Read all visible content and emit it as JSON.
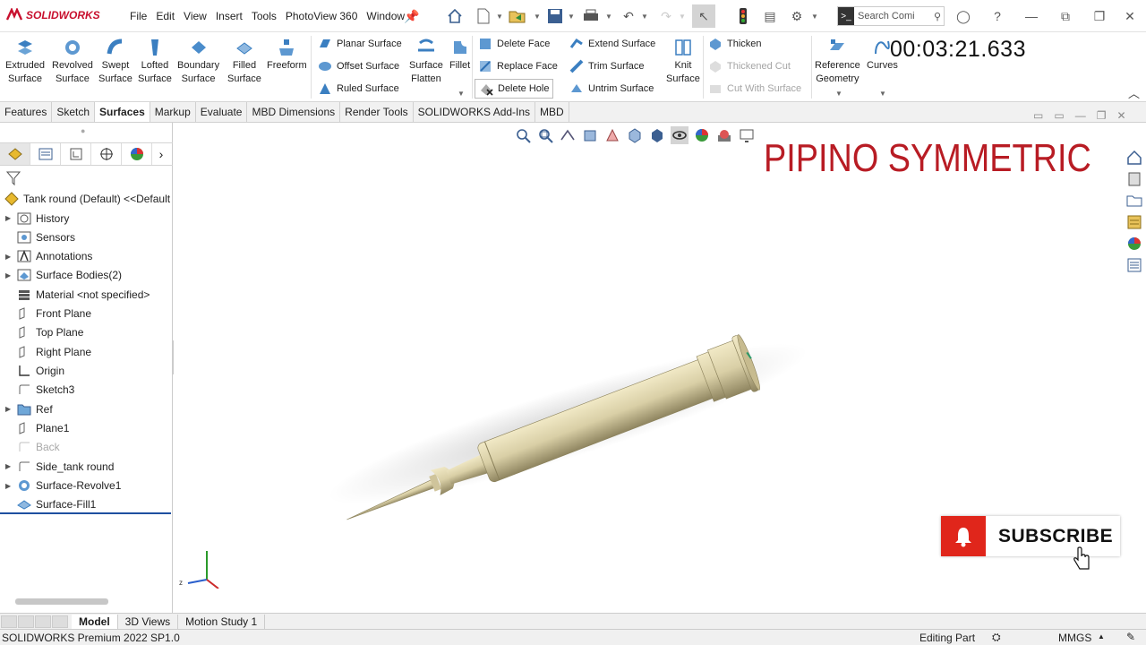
{
  "app": {
    "brand": "SOLIDWORKS"
  },
  "menu": [
    "File",
    "Edit",
    "View",
    "Insert",
    "Tools",
    "PhotoView 360",
    "Window"
  ],
  "search": {
    "placeholder": "Search Comi"
  },
  "ribbon": {
    "extruded_surface": "Extruded\nSurface",
    "revolved_surface": "Revolved\nSurface",
    "swept_surface": "Swept\nSurface",
    "lofted_surface": "Lofted\nSurface",
    "boundary_surface": "Boundary\nSurface",
    "filled_surface": "Filled\nSurface",
    "freeform": "Freeform",
    "planar_surface": "Planar Surface",
    "offset_surface": "Offset Surface",
    "ruled_surface": "Ruled Surface",
    "surface_flatten": "Surface\nFlatten",
    "fillet": "Fillet",
    "delete_face": "Delete Face",
    "replace_face": "Replace Face",
    "delete_hole": "Delete Hole",
    "extend_surface": "Extend Surface",
    "trim_surface": "Trim Surface",
    "untrim_surface": "Untrim Surface",
    "knit_surface": "Knit\nSurface",
    "thicken": "Thicken",
    "thickened_cut": "Thickened Cut",
    "cut_with_surface": "Cut With Surface",
    "reference_geometry": "Reference\nGeometry",
    "curves": "Curves"
  },
  "timer": "00:03:21.633",
  "tabs": [
    "Features",
    "Sketch",
    "Surfaces",
    "Markup",
    "Evaluate",
    "MBD Dimensions",
    "Render Tools",
    "SOLIDWORKS Add-Ins",
    "MBD"
  ],
  "active_tab": "Surfaces",
  "tree": {
    "root": "Tank round (Default) <<Default",
    "items": [
      {
        "label": "History",
        "icon": "history-icon",
        "expand": true,
        "disabled": false
      },
      {
        "label": "Sensors",
        "icon": "sensor-icon",
        "expand": false,
        "disabled": false
      },
      {
        "label": "Annotations",
        "icon": "annotation-icon",
        "expand": true,
        "disabled": false
      },
      {
        "label": "Surface Bodies(2)",
        "icon": "surface-bodies-icon",
        "expand": true,
        "disabled": false
      },
      {
        "label": "Material <not specified>",
        "icon": "material-icon",
        "expand": false,
        "disabled": false
      },
      {
        "label": "Front Plane",
        "icon": "plane-icon",
        "expand": false,
        "disabled": false
      },
      {
        "label": "Top Plane",
        "icon": "plane-icon",
        "expand": false,
        "disabled": false
      },
      {
        "label": "Right Plane",
        "icon": "plane-icon",
        "expand": false,
        "disabled": false
      },
      {
        "label": "Origin",
        "icon": "origin-icon",
        "expand": false,
        "disabled": false
      },
      {
        "label": "Sketch3",
        "icon": "sketch-icon",
        "expand": false,
        "disabled": false
      },
      {
        "label": "Ref",
        "icon": "folder-icon",
        "expand": true,
        "disabled": false
      },
      {
        "label": "Plane1",
        "icon": "plane-icon",
        "expand": false,
        "disabled": false
      },
      {
        "label": "Back",
        "icon": "sketch-icon",
        "expand": false,
        "disabled": true
      },
      {
        "label": "Side_tank round",
        "icon": "sketch-icon",
        "expand": true,
        "disabled": false
      },
      {
        "label": "Surface-Revolve1",
        "icon": "revolve-icon",
        "expand": true,
        "disabled": false
      },
      {
        "label": "Surface-Fill1",
        "icon": "fill-surface-icon",
        "expand": false,
        "disabled": false
      }
    ]
  },
  "overlay": {
    "title": "PIPINO SYMMETRIC",
    "subscribe": "SUBSCRIBE"
  },
  "bottom_tabs": [
    "Model",
    "3D Views",
    "Motion Study 1"
  ],
  "status": {
    "product": "SOLIDWORKS Premium 2022 SP1.0",
    "mode": "Editing Part",
    "units": "MMGS"
  },
  "colors": {
    "brand_red": "#c8102e",
    "title_red": "#b81c24",
    "part_body": "#d9cfa6",
    "subscribe_red": "#e0261b"
  }
}
